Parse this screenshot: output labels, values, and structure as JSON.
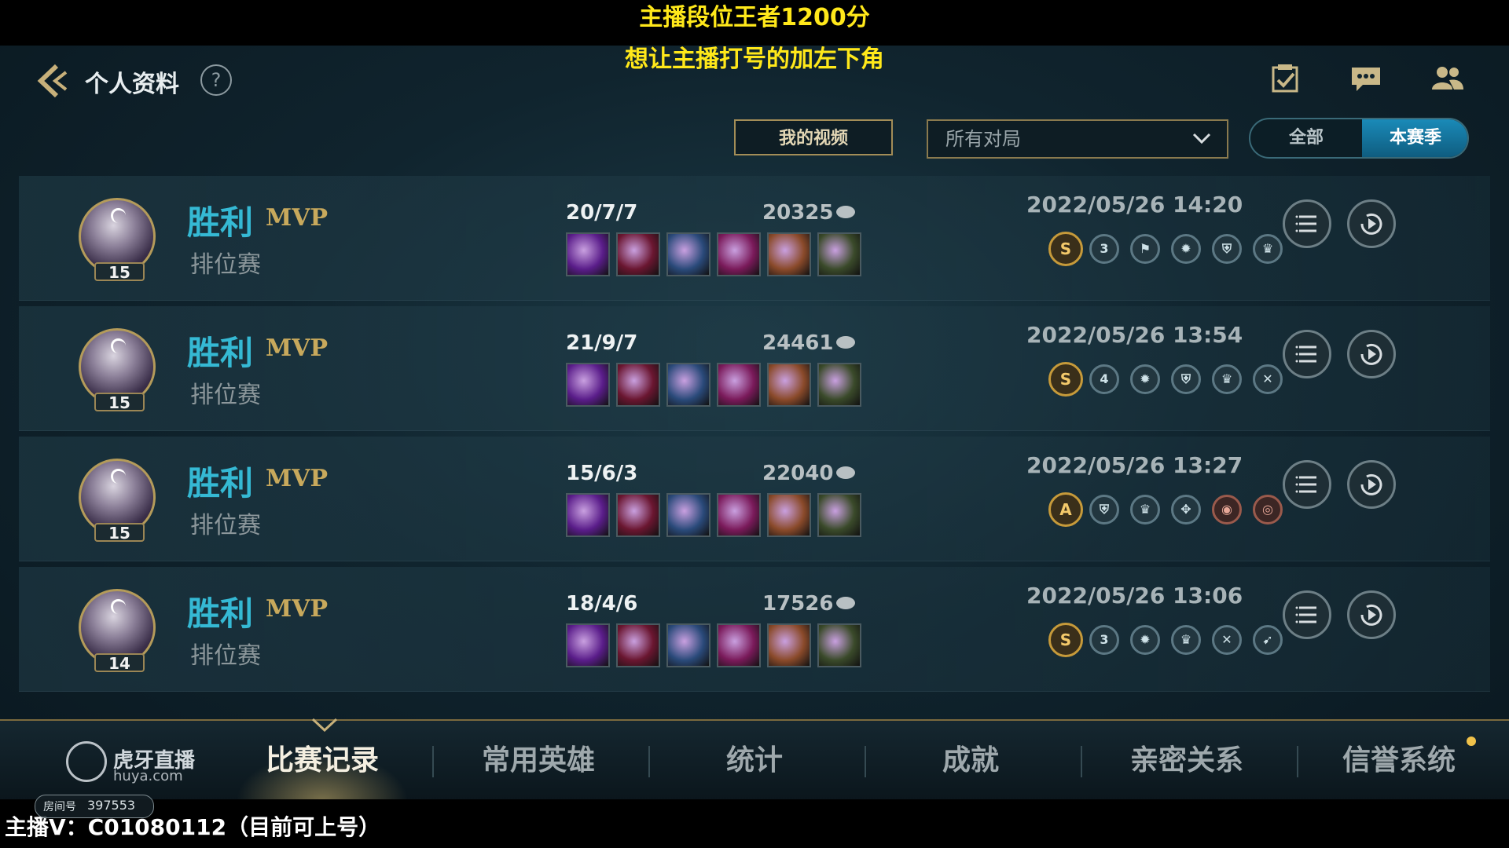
{
  "overlay": {
    "line1": "主播段位王者1200分",
    "line2": "想让主播打号的加左下角",
    "bottom": "主播V：C01080112（目前可上号）"
  },
  "header": {
    "title": "个人资料",
    "help": "?",
    "icons": [
      "checklist-icon",
      "chat-icon",
      "friends-icon"
    ]
  },
  "toolbar": {
    "videos_label": "我的视频",
    "match_filter_value": "所有对局",
    "toggle_all": "全部",
    "toggle_season": "本赛季",
    "toggle_selected": "本赛季"
  },
  "matches": [
    {
      "result": "胜利",
      "mvp": "MVP",
      "mode": "排位赛",
      "level": "15",
      "kda": "20/7/7",
      "gold": "20325",
      "datetime": "2022/05/26 14:20",
      "grade": "S",
      "badges": [
        "3",
        "flag",
        "fire",
        "shield",
        "crown"
      ]
    },
    {
      "result": "胜利",
      "mvp": "MVP",
      "mode": "排位赛",
      "level": "15",
      "kda": "21/9/7",
      "gold": "24461",
      "datetime": "2022/05/26 13:54",
      "grade": "S",
      "badges": [
        "4",
        "fire",
        "shield",
        "crown",
        "sword"
      ]
    },
    {
      "result": "胜利",
      "mvp": "MVP",
      "mode": "排位赛",
      "level": "15",
      "kda": "15/6/3",
      "gold": "22040",
      "datetime": "2022/05/26 13:27",
      "grade": "A",
      "badges": [
        "shield",
        "crown",
        "target",
        "coin",
        "guard"
      ]
    },
    {
      "result": "胜利",
      "mvp": "MVP",
      "mode": "排位赛",
      "level": "14",
      "kda": "18/4/6",
      "gold": "17526",
      "datetime": "2022/05/26 13:06",
      "grade": "S",
      "badges": [
        "3",
        "fire",
        "crown",
        "sword",
        "arrow"
      ]
    }
  ],
  "items_colors": [
    "#5a1d8a",
    "#6a1630",
    "#2a4a7a",
    "#7a1a5a",
    "#8a4a2a",
    "#3a4a2a"
  ],
  "tabs": [
    "比赛记录",
    "常用英雄",
    "统计",
    "成就",
    "亲密关系",
    "信誉系统"
  ],
  "active_tab": "比赛记录",
  "watermark": {
    "brand": "虎牙直播",
    "url": "huya.com",
    "room_label": "房间号",
    "room_number": "397553"
  }
}
